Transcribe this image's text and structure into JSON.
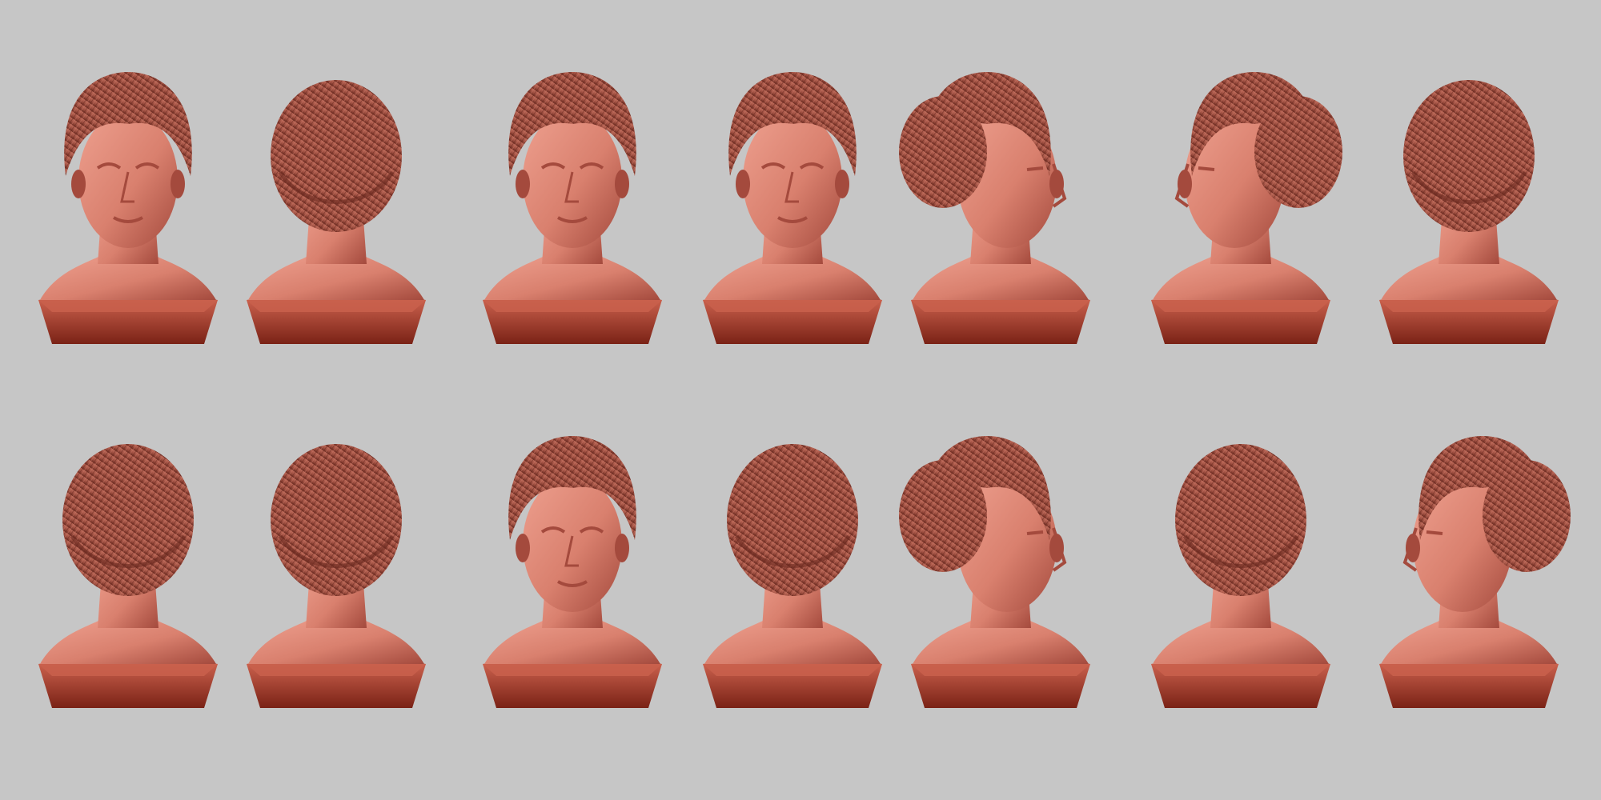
{
  "scene": {
    "background_color": "#c6c6c6",
    "material": {
      "skin": "#d9806e",
      "skin_light": "#eea08f",
      "skin_shadow": "#a44a3d",
      "hair": "#9a4c3e",
      "hair_dark": "#6a2a20",
      "hair_light": "#bf6b5a",
      "base_top": "#c9604c",
      "base_side": "#7a2216"
    },
    "grid": {
      "rows": 2,
      "columns": 7
    },
    "views": [
      {
        "id": "r1c1",
        "view": "front"
      },
      {
        "id": "r1c2",
        "view": "back-left"
      },
      {
        "id": "r1c3",
        "view": "front"
      },
      {
        "id": "r1c4",
        "view": "front"
      },
      {
        "id": "r1c5",
        "view": "right-profile"
      },
      {
        "id": "r1c6",
        "view": "three-quarter-left"
      },
      {
        "id": "r1c7",
        "view": "back-right"
      },
      {
        "id": "r2c1",
        "view": "back-right"
      },
      {
        "id": "r2c2",
        "view": "back"
      },
      {
        "id": "r2c3",
        "view": "front-high"
      },
      {
        "id": "r2c4",
        "view": "top-down-left"
      },
      {
        "id": "r2c5",
        "view": "right-profile"
      },
      {
        "id": "r2c6",
        "view": "back-left"
      },
      {
        "id": "r2c7",
        "view": "left-profile"
      }
    ]
  }
}
